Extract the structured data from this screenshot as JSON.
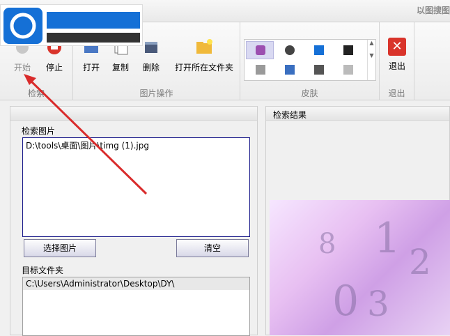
{
  "window": {
    "title": "以图搜图"
  },
  "ribbon": {
    "group_search": {
      "label": "检索",
      "start": "开始",
      "stop": "停止"
    },
    "group_image": {
      "label": "图片操作",
      "open": "打开",
      "copy": "复制",
      "delete": "删除",
      "open_folder": "打开所在文件夹"
    },
    "group_skin": {
      "label": "皮肤"
    },
    "group_exit": {
      "label": "退出",
      "exit": "退出"
    }
  },
  "left_panel": {
    "search_image_label": "检索图片",
    "search_image_path": "D:\\tools\\桌面\\图片\\timg (1).jpg",
    "select_button": "选择图片",
    "clear_button": "清空",
    "target_folder_label": "目标文件夹",
    "target_folder_path": "C:\\Users\\Administrator\\Desktop\\DY\\"
  },
  "right_panel": {
    "title": "检索结果"
  },
  "colors": {
    "accent_blue": "#1570d6",
    "exit_red": "#d9342b",
    "arrow_red": "#d92b2b"
  },
  "icons": [
    "start-icon",
    "stop-icon",
    "open-icon",
    "copy-icon",
    "delete-icon",
    "folder-icon",
    "exit-icon"
  ]
}
